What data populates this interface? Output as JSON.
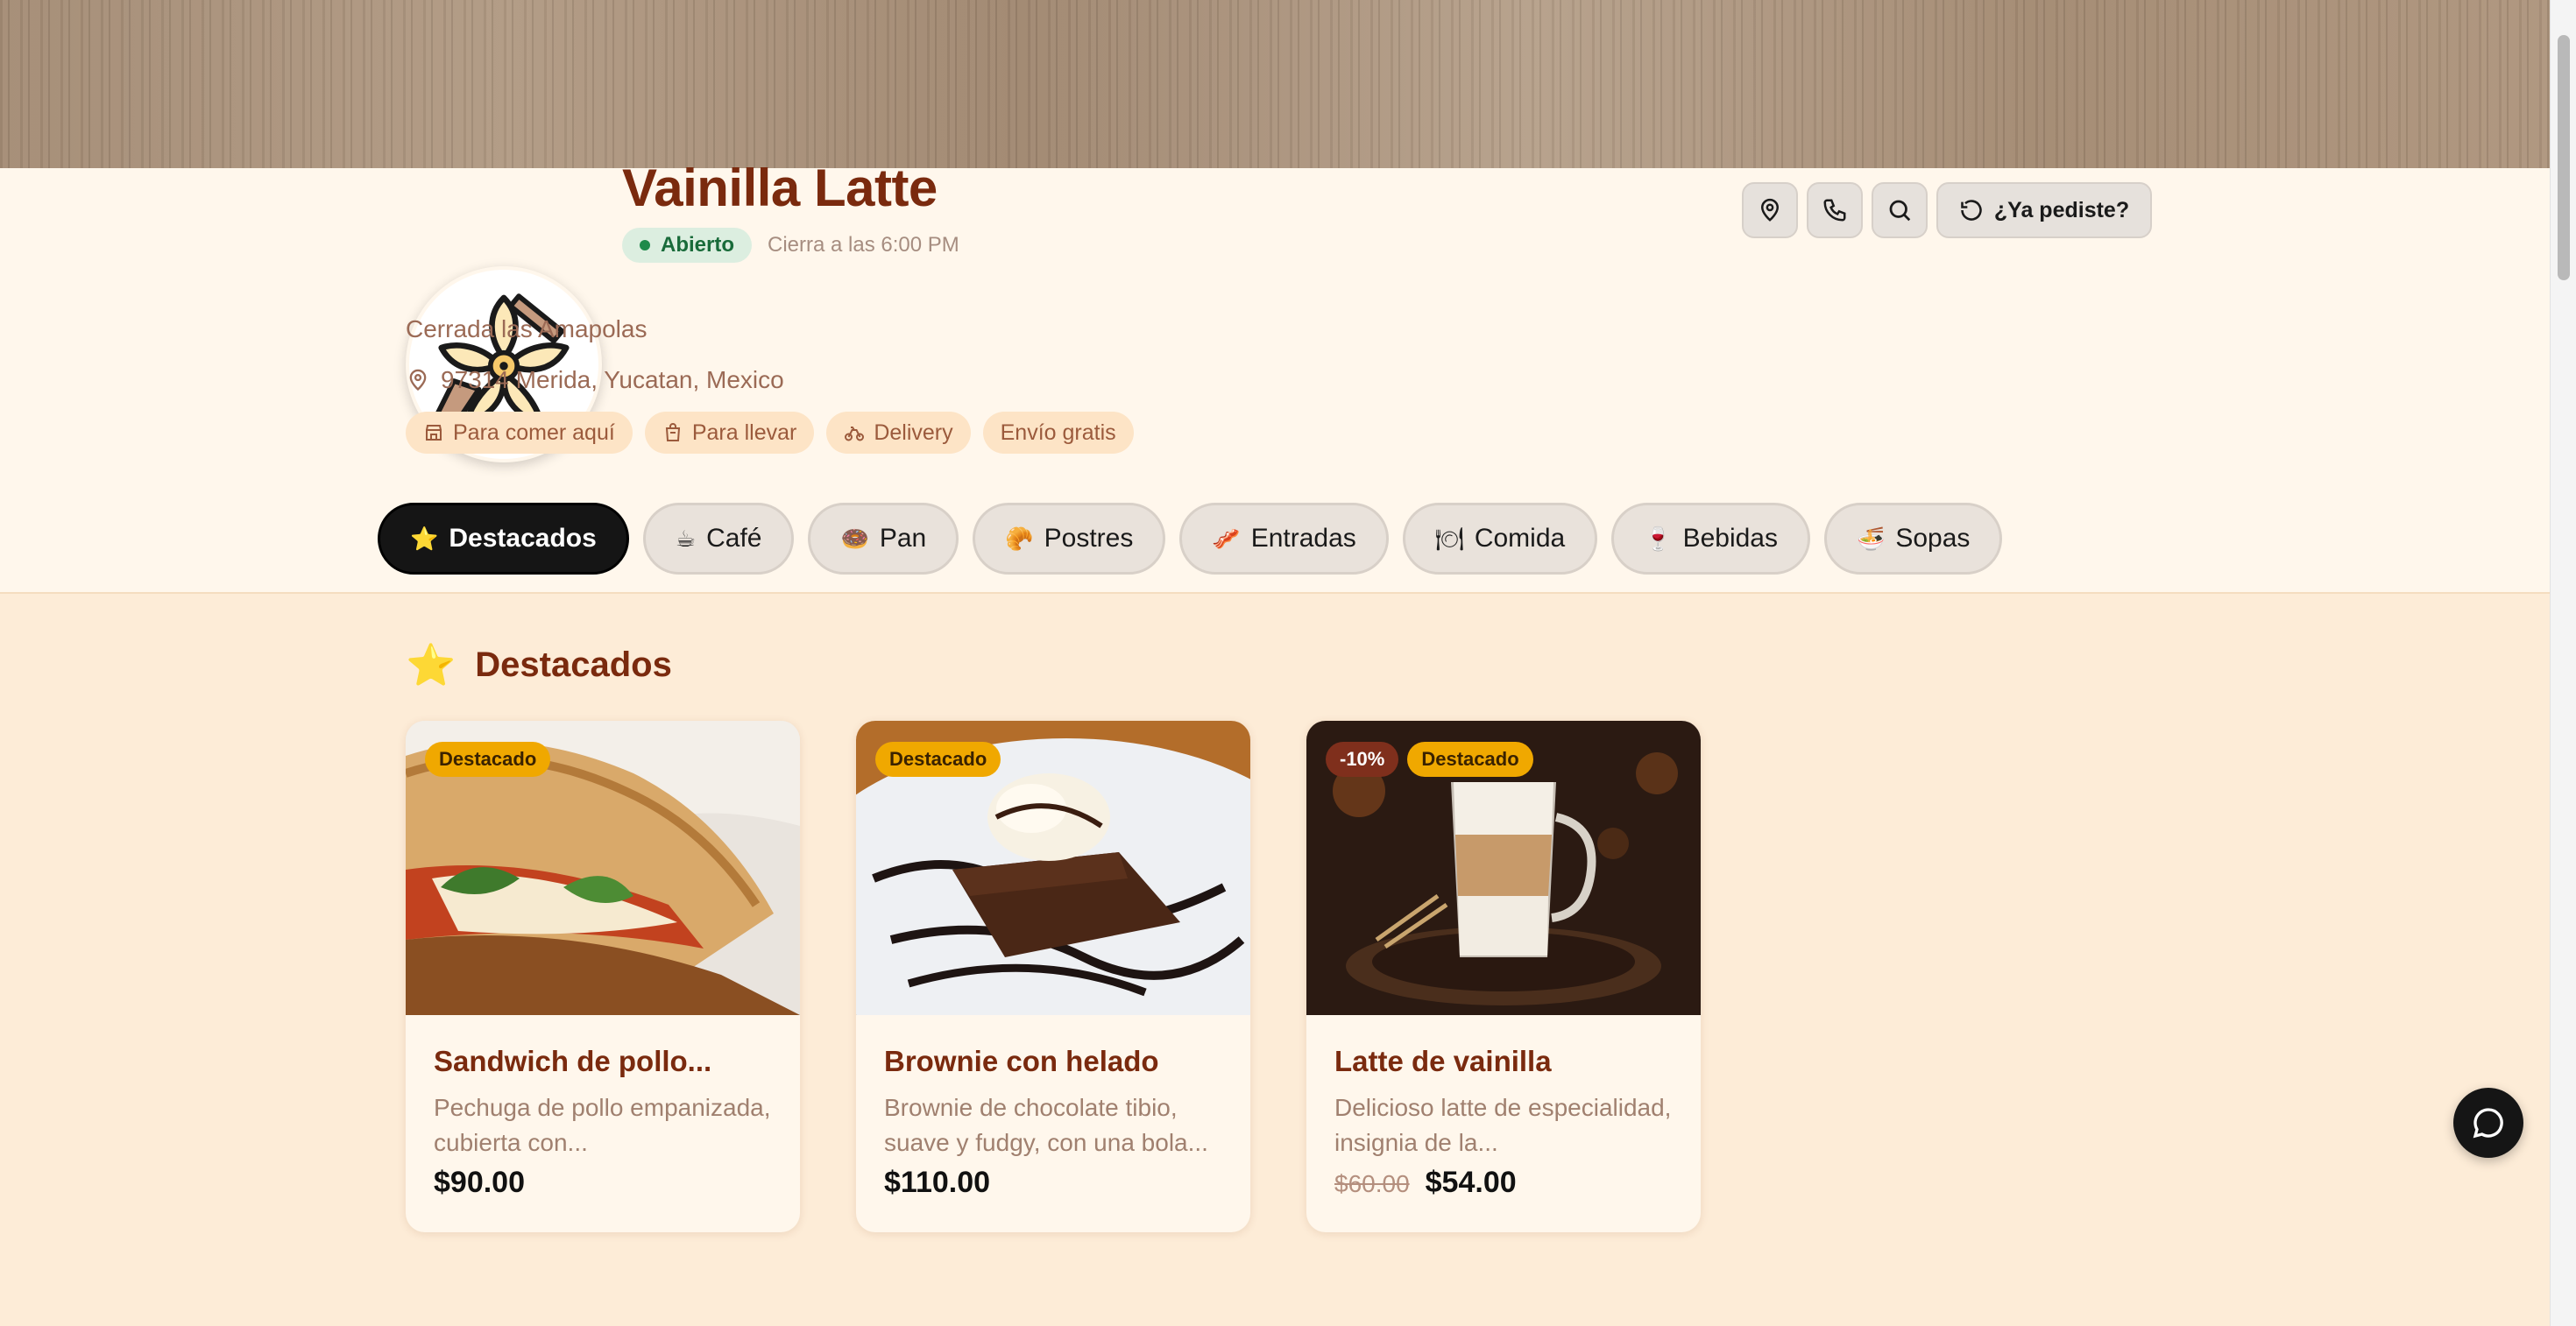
{
  "store": {
    "name": "Vainilla Latte",
    "status": "Abierto",
    "closing": "Cierra a las 6:00 PM",
    "address_line1": "Cerrada las Amapolas",
    "address_line2": "97314 Merida, Yucatan, Mexico"
  },
  "services": [
    {
      "icon": "store-icon",
      "label": "Para comer aquí"
    },
    {
      "icon": "bag-icon",
      "label": "Para llevar"
    },
    {
      "icon": "bike-icon",
      "label": "Delivery"
    },
    {
      "icon": "",
      "label": "Envío gratis"
    }
  ],
  "actions": {
    "location_icon": "map-pin-icon",
    "phone_icon": "phone-icon",
    "search_icon": "search-icon",
    "reorder_label": "¿Ya pediste?"
  },
  "tabs": [
    {
      "emoji": "⭐",
      "label": "Destacados",
      "active": true
    },
    {
      "emoji": "☕",
      "label": "Café"
    },
    {
      "emoji": "🍩",
      "label": "Pan"
    },
    {
      "emoji": "🥐",
      "label": "Postres"
    },
    {
      "emoji": "🥓",
      "label": "Entradas"
    },
    {
      "emoji": "🍽",
      "label": "Comida"
    },
    {
      "emoji": "🍷",
      "label": "Bebidas"
    },
    {
      "emoji": "🍜",
      "label": "Sopas"
    }
  ],
  "section": {
    "emoji": "⭐",
    "title": "Destacados"
  },
  "products": [
    {
      "badge": "Destacado",
      "title": "Sandwich de pollo...",
      "desc": "Pechuga de pollo empanizada, cubierta con...",
      "price": "$90.00"
    },
    {
      "badge": "Destacado",
      "title": "Brownie con helado",
      "desc": "Brownie de chocolate tibio, suave y fudgy, con una bola...",
      "price": "$110.00"
    },
    {
      "discount": "-10%",
      "badge": "Destacado",
      "title": "Latte de vainilla",
      "desc": "Delicioso latte de especialidad, insignia de la...",
      "old_price": "$60.00",
      "price": "$54.00"
    }
  ],
  "chat_icon": "chat-bubble-icon",
  "colors": {
    "brand": "#7a2a0e",
    "background": "#fdecd7",
    "header_bg": "#fff7ec",
    "badge": "#f0a800",
    "open_badge_bg": "#dceee0"
  }
}
